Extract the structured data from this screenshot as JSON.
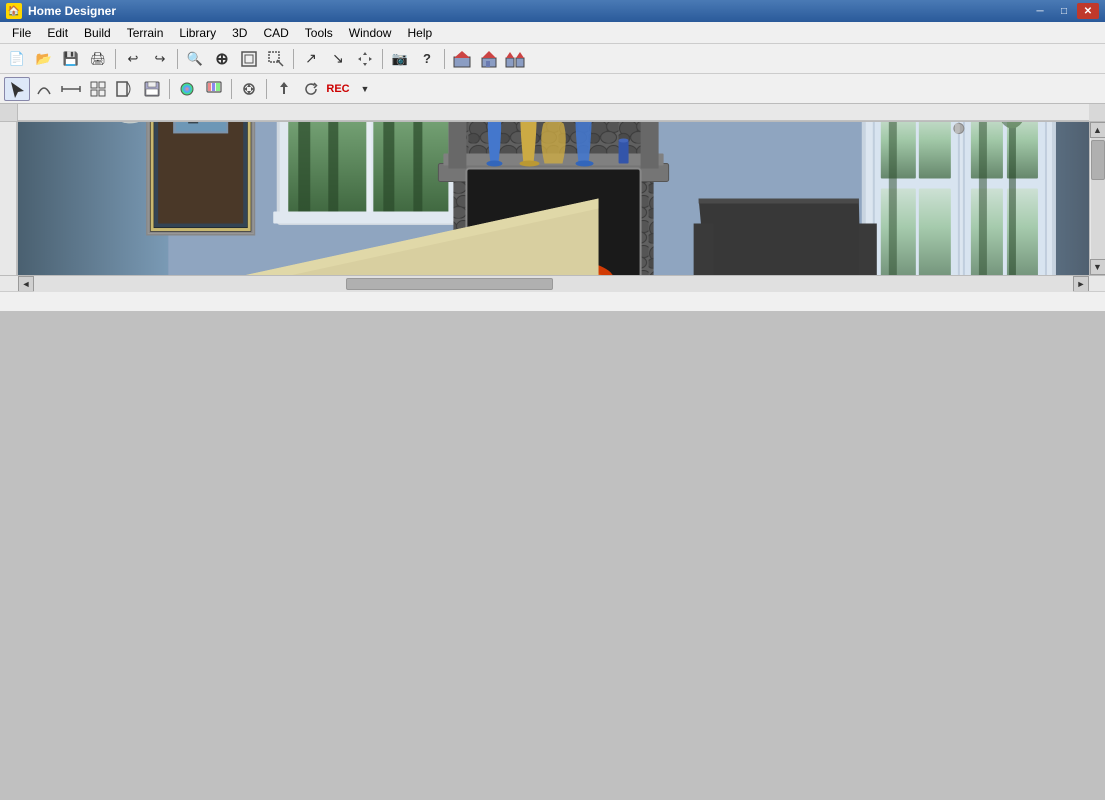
{
  "window": {
    "title": "Home Designer",
    "icon": "🏠"
  },
  "titlebar": {
    "minimize": "─",
    "maximize": "□",
    "close": "✕"
  },
  "menubar": {
    "items": [
      "File",
      "Edit",
      "Build",
      "Terrain",
      "Library",
      "3D",
      "CAD",
      "Tools",
      "Window",
      "Help"
    ]
  },
  "toolbar1": {
    "buttons": [
      {
        "name": "new",
        "icon": "📄",
        "title": "New"
      },
      {
        "name": "open",
        "icon": "📂",
        "title": "Open"
      },
      {
        "name": "save",
        "icon": "💾",
        "title": "Save"
      },
      {
        "name": "print",
        "icon": "🖨",
        "title": "Print"
      },
      {
        "sep": true
      },
      {
        "name": "undo",
        "icon": "↩",
        "title": "Undo"
      },
      {
        "name": "redo",
        "icon": "↪",
        "title": "Redo"
      },
      {
        "sep": true
      },
      {
        "name": "zoom-out",
        "icon": "🔍",
        "title": "Zoom Out"
      },
      {
        "name": "zoom-in",
        "icon": "⊕",
        "title": "Zoom In"
      },
      {
        "name": "zoom-fit",
        "icon": "⊞",
        "title": "Zoom to Fit"
      },
      {
        "name": "zoom-sel",
        "icon": "⊡",
        "title": "Zoom Selection"
      },
      {
        "sep": true
      },
      {
        "name": "pan",
        "icon": "✋",
        "title": "Pan"
      },
      {
        "name": "select",
        "icon": "↗",
        "title": "Select"
      },
      {
        "sep": true
      },
      {
        "name": "camera",
        "icon": "📷",
        "title": "Camera"
      },
      {
        "name": "help",
        "icon": "?",
        "title": "Help"
      },
      {
        "sep": true
      },
      {
        "name": "house1",
        "icon": "🏠",
        "title": "Floor Plan"
      },
      {
        "name": "house2",
        "icon": "🏡",
        "title": "3D View"
      },
      {
        "name": "house3",
        "icon": "🏘",
        "title": "Overview"
      }
    ]
  },
  "toolbar2": {
    "buttons": [
      {
        "name": "pointer",
        "icon": "↖",
        "title": "Pointer"
      },
      {
        "name": "line",
        "icon": "╱",
        "title": "Line"
      },
      {
        "name": "wall",
        "icon": "⊟",
        "title": "Wall"
      },
      {
        "name": "room",
        "icon": "▦",
        "title": "Room"
      },
      {
        "name": "door",
        "icon": "🚪",
        "title": "Door"
      },
      {
        "sep": true
      },
      {
        "name": "material",
        "icon": "🎨",
        "title": "Material"
      },
      {
        "name": "texture",
        "icon": "🖌",
        "title": "Texture"
      },
      {
        "sep": true
      },
      {
        "name": "move",
        "icon": "✥",
        "title": "Move"
      },
      {
        "sep": true
      },
      {
        "name": "up",
        "icon": "↑",
        "title": "Up"
      },
      {
        "name": "rotate",
        "icon": "↻",
        "title": "Rotate"
      },
      {
        "name": "rec",
        "icon": "⏺",
        "title": "Record"
      }
    ]
  },
  "viewport": {
    "background_color": "#6a8aaa",
    "scene_type": "3d_bedroom"
  },
  "statusbar": {
    "text": ""
  }
}
